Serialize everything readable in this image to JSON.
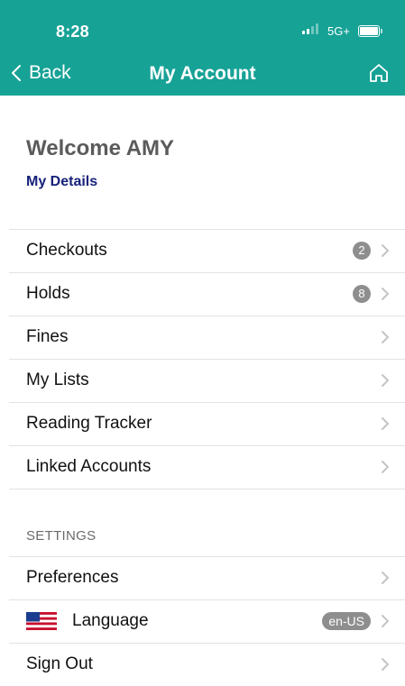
{
  "status_bar": {
    "time": "8:28",
    "network": "5G+"
  },
  "nav": {
    "back_label": "Back",
    "title": "My Account",
    "home_icon": "home-icon"
  },
  "account": {
    "welcome": "Welcome AMY",
    "details_link": "My Details"
  },
  "menu": [
    {
      "label": "Checkouts",
      "badge": "2"
    },
    {
      "label": "Holds",
      "badge": "8"
    },
    {
      "label": "Fines"
    },
    {
      "label": "My Lists"
    },
    {
      "label": "Reading Tracker"
    },
    {
      "label": "Linked Accounts"
    }
  ],
  "settings": {
    "header": "SETTINGS",
    "items": [
      {
        "label": "Preferences"
      },
      {
        "label": "Language",
        "value": "en-US",
        "icon": "us-flag-icon"
      },
      {
        "label": "Sign Out"
      }
    ]
  },
  "colors": {
    "header_bg": "#17a296",
    "link": "#16227a",
    "badge_bg": "#8e8e8e"
  }
}
